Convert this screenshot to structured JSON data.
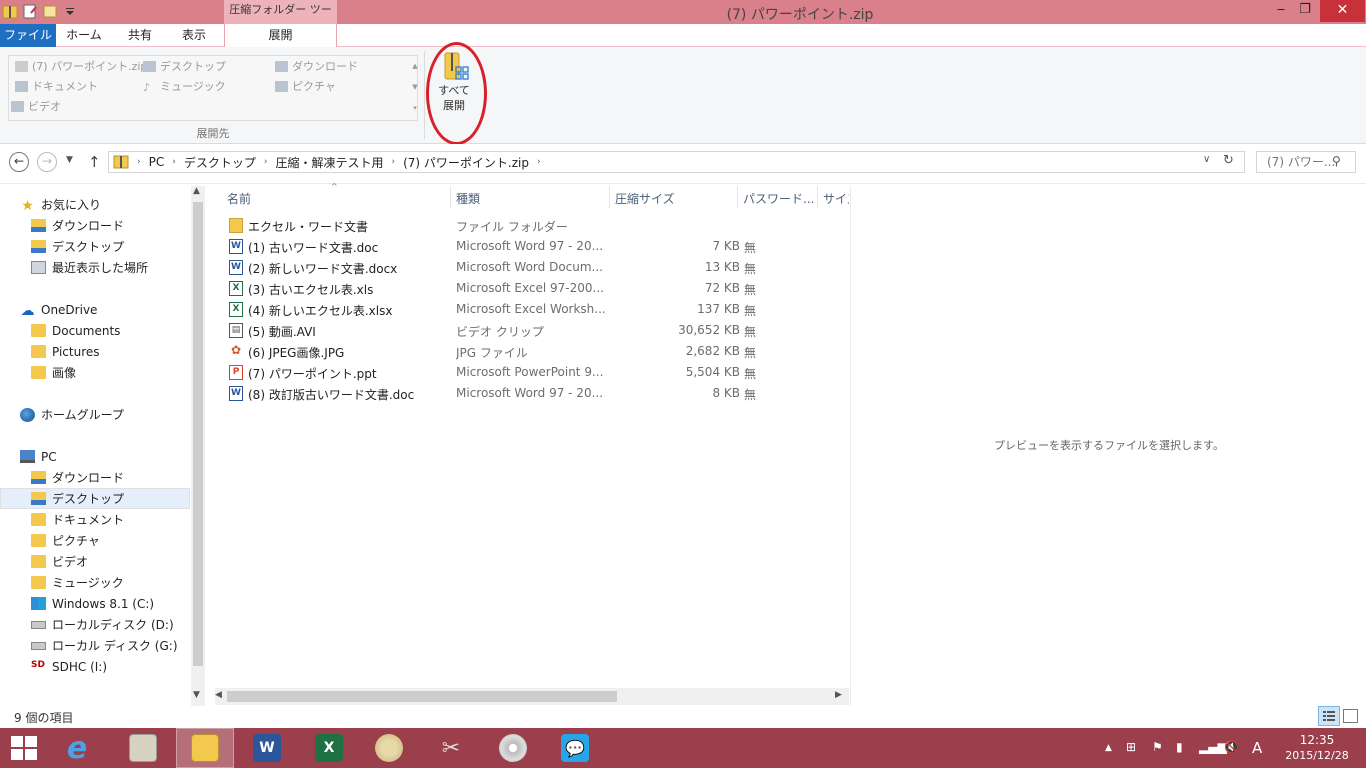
{
  "window": {
    "title": "(7) パワーポイント.zip",
    "context_tab_label": "圧縮フォルダー ツール",
    "minimize": "‒",
    "maximize": "❐",
    "close": "✕"
  },
  "tabs": {
    "file": "ファイル",
    "home": "ホーム",
    "share": "共有",
    "view": "表示",
    "extract": "展開"
  },
  "ribbon": {
    "destinations": [
      "(7) パワーポイント.zip",
      "デスクトップ",
      "ダウンロード",
      "ドキュメント",
      "ミュージック",
      "ピクチャ",
      "ビデオ"
    ],
    "group_label": "展開先",
    "extract_all_line1": "すべて",
    "extract_all_line2": "展開"
  },
  "address": {
    "crumbs": [
      "PC",
      "デスクトップ",
      "圧縮・解凍テスト用",
      "(7) パワーポイント.zip"
    ],
    "search_placeholder": "(7) パワー..."
  },
  "navpane": {
    "favorites": "お気に入り",
    "fav_items": [
      "ダウンロード",
      "デスクトップ",
      "最近表示した場所"
    ],
    "onedrive": "OneDrive",
    "onedrive_items": [
      "Documents",
      "Pictures",
      "画像"
    ],
    "homegroup": "ホームグループ",
    "pc": "PC",
    "pc_items": [
      "ダウンロード",
      "デスクトップ",
      "ドキュメント",
      "ピクチャ",
      "ビデオ",
      "ミュージック",
      "Windows 8.1 (C:)",
      "ローカルディスク (D:)",
      "ローカル ディスク (G:)",
      "SDHC (I:)"
    ]
  },
  "columns": {
    "name": "名前",
    "type": "種類",
    "compressed_size": "圧縮サイズ",
    "password": "パスワード...",
    "size": "サイズ"
  },
  "files": [
    {
      "name": "エクセル・ワード文書",
      "type": "ファイル フォルダー",
      "size": "",
      "password": "",
      "icon": "folder"
    },
    {
      "name": "(1) 古いワード文書.doc",
      "type": "Microsoft Word 97 - 20...",
      "size": "7 KB",
      "password": "無",
      "icon": "word"
    },
    {
      "name": "(2) 新しいワード文書.docx",
      "type": "Microsoft Word Docum...",
      "size": "13 KB",
      "password": "無",
      "icon": "word"
    },
    {
      "name": "(3) 古いエクセル表.xls",
      "type": "Microsoft Excel 97-200...",
      "size": "72 KB",
      "password": "無",
      "icon": "excel"
    },
    {
      "name": "(4) 新しいエクセル表.xlsx",
      "type": "Microsoft Excel Worksh...",
      "size": "137 KB",
      "password": "無",
      "icon": "excel"
    },
    {
      "name": "(5) 動画.AVI",
      "type": "ビデオ クリップ",
      "size": "30,652 KB",
      "password": "無",
      "icon": "video"
    },
    {
      "name": "(6)  JPEG画像.JPG",
      "type": "JPG ファイル",
      "size": "2,682 KB",
      "password": "無",
      "icon": "jpg"
    },
    {
      "name": "(7) パワーポイント.ppt",
      "type": "Microsoft PowerPoint 9...",
      "size": "5,504 KB",
      "password": "無",
      "icon": "ppt"
    },
    {
      "name": "(8) 改訂版古いワード文書.doc",
      "type": "Microsoft Word 97 - 20...",
      "size": "8 KB",
      "password": "無",
      "icon": "word"
    }
  ],
  "preview": {
    "message": "プレビューを表示するファイルを選択します。"
  },
  "status": {
    "item_count": "9 個の項目"
  },
  "taskbar": {
    "apps": [
      "internet-explorer",
      "news-reader",
      "file-explorer",
      "word",
      "excel",
      "paint",
      "snipping-tool",
      "media-player",
      "messenger"
    ],
    "ime": "A",
    "time": "12:35",
    "date": "2015/12/28"
  },
  "colors": {
    "titlebar": "#d9808a",
    "file_tab": "#1f6fc1",
    "taskbar": "#9b3f4c",
    "highlight_circle": "#d9202a"
  }
}
